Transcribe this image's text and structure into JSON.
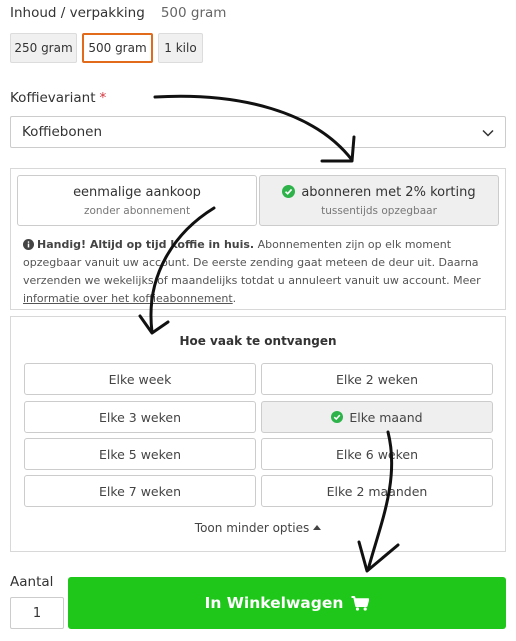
{
  "packaging": {
    "label": "Inhoud / verpakking",
    "selected_value": "500 gram",
    "options": [
      "250 gram",
      "500 gram",
      "1 kilo"
    ],
    "selected_index": 1
  },
  "variant": {
    "label": "Koffievariant",
    "required_mark": "*",
    "selected": "Koffiebonen"
  },
  "subscription": {
    "options": [
      {
        "title": "eenmalige aankoop",
        "subtitle": "zonder abonnement"
      },
      {
        "title": "abonneren met 2% korting",
        "subtitle": "tussentijds opzegbaar"
      }
    ],
    "selected_index": 1,
    "info_bold": "Handig! Altijd op tijd koffie in huis.",
    "info_text": "Abonnementen zijn op elk moment opzegbaar vanuit uw account. De eerste zending gaat meteen de deur uit. Daarna verzenden we wekelijks of maandelijks totdat u annuleert vanuit uw account. Meer",
    "info_link": "informatie over het koffieabonnement",
    "info_end": "."
  },
  "frequency": {
    "title": "Hoe vaak te ontvangen",
    "options": [
      "Elke week",
      "Elke 2 weken",
      "Elke 3 weken",
      "Elke maand",
      "Elke 5 weken",
      "Elke 6 weken",
      "Elke 7 weken",
      "Elke 2 maanden"
    ],
    "selected_index": 3,
    "less_options": "Toon minder opties"
  },
  "quantity": {
    "label": "Aantal",
    "value": "1"
  },
  "cart": {
    "label": "In Winkelwagen"
  },
  "colors": {
    "accent_orange": "#e26a1b",
    "cart_green": "#1ec71a",
    "check_green": "#2db34a",
    "required_red": "#d6323b"
  }
}
